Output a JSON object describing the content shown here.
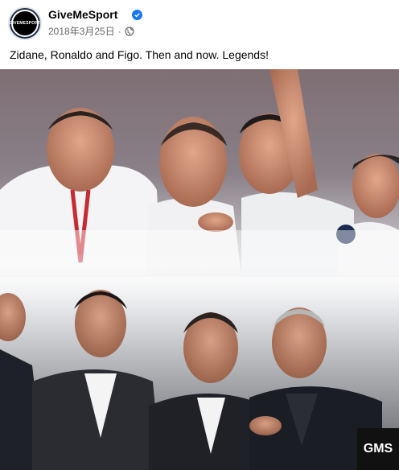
{
  "post": {
    "page_name": "GiveMeSport",
    "date": "2018年3月25日",
    "separator": "·",
    "text": "Zidane, Ronaldo and Figo. Then and now. Legends!",
    "avatar_text": "GIVEMESPORT",
    "watermark": "GMS"
  },
  "icons": {
    "verified": "verified-badge-icon",
    "privacy": "globe-icon"
  },
  "colors": {
    "verified_blue": "#1877f2",
    "meta_gray": "#65676b"
  }
}
